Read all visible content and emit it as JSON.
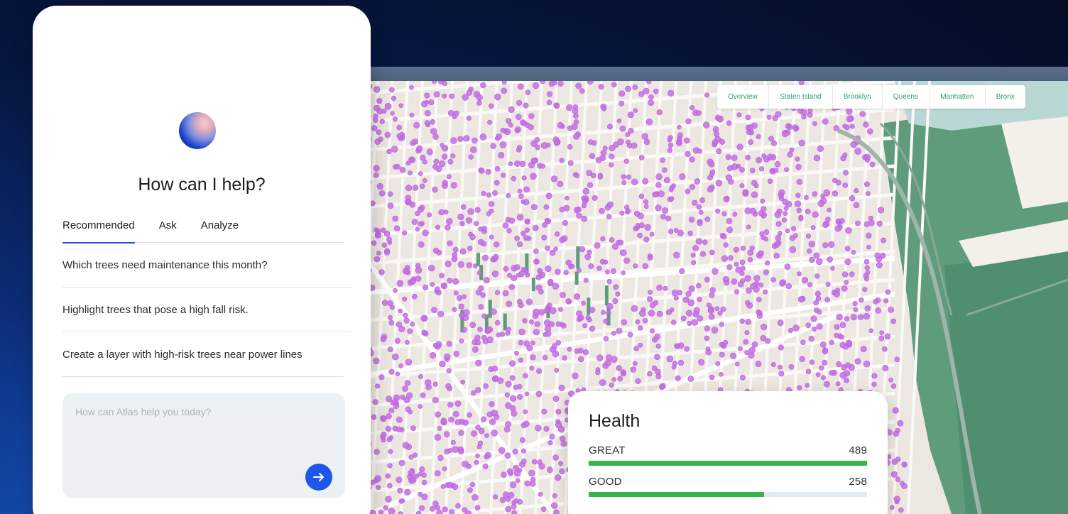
{
  "map": {
    "tabs": [
      {
        "label": "Overview"
      },
      {
        "label": "Staten Island"
      },
      {
        "label": "Brooklyn"
      },
      {
        "label": "Queens"
      },
      {
        "label": "Manhatten"
      },
      {
        "label": "Bronx"
      }
    ],
    "colors": {
      "land": "#ece7e0",
      "block": "#e2d9cf",
      "road": "#fbf9f6",
      "park": "#5e9c7c",
      "water": "#b8d7d5",
      "tree": "#c56ee6"
    }
  },
  "health": {
    "title": "Health",
    "rows": [
      {
        "label": "GREAT",
        "value": "489",
        "fraction": 1.0
      },
      {
        "label": "GOOD",
        "value": "258",
        "fraction": 0.63
      }
    ]
  },
  "chat": {
    "title": "How can I help?",
    "tabs": [
      {
        "label": "Recommended",
        "active": true
      },
      {
        "label": "Ask",
        "active": false
      },
      {
        "label": "Analyze",
        "active": false
      }
    ],
    "suggestions": [
      {
        "text": "Which trees need maintenance this month?"
      },
      {
        "text": "Highlight trees that pose a high fall risk."
      },
      {
        "text": "Create a layer with high-risk trees near power lines"
      }
    ],
    "input": {
      "value": "",
      "placeholder": "How can Atlas help you today?"
    },
    "send_icon": "arrow-right-icon",
    "accent": "#1d56e8"
  }
}
